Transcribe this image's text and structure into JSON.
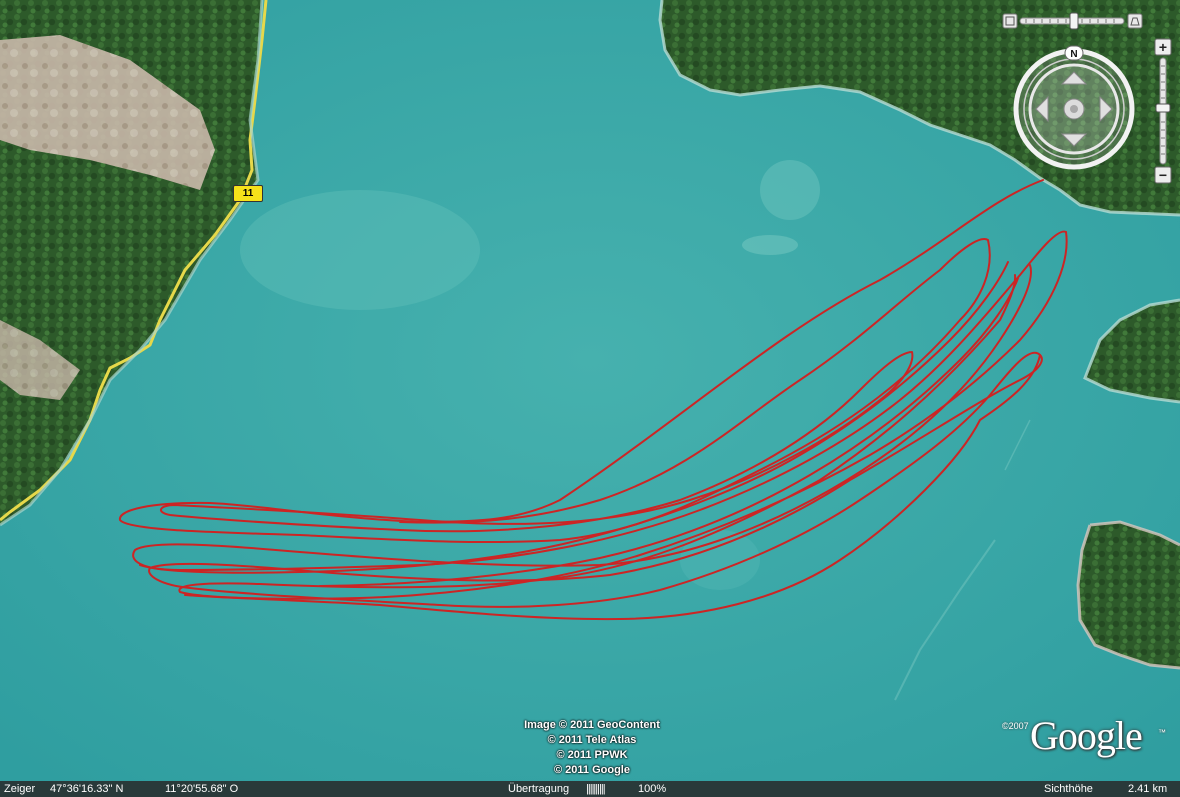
{
  "map": {
    "road_number": "11",
    "track_color": "#d41e1e",
    "water_color": "#3aa5a5",
    "forest_color": "#2f5a2c",
    "road_color": "#e6d84a"
  },
  "attribution": {
    "lines": [
      "Image © 2011 GeoContent",
      "© 2011 Tele Atlas",
      "© 2011 PPWK",
      "© 2011 Google"
    ]
  },
  "logo": {
    "text": "Google",
    "year": "©2007",
    "tm": "™"
  },
  "status_bar": {
    "pointer_label": "Zeiger",
    "lat": "47°36'16.33\" N",
    "lon": "11°20'55.68\" O",
    "streaming_label": "Übertragung",
    "streaming_bar": "||||||||||",
    "streaming_pct": "100%",
    "eye_alt_label": "Sichthöhe",
    "eye_alt_value": "2.41 km"
  },
  "controls": {
    "compass_north": "N",
    "zoom_in": "+",
    "zoom_out": "−"
  }
}
